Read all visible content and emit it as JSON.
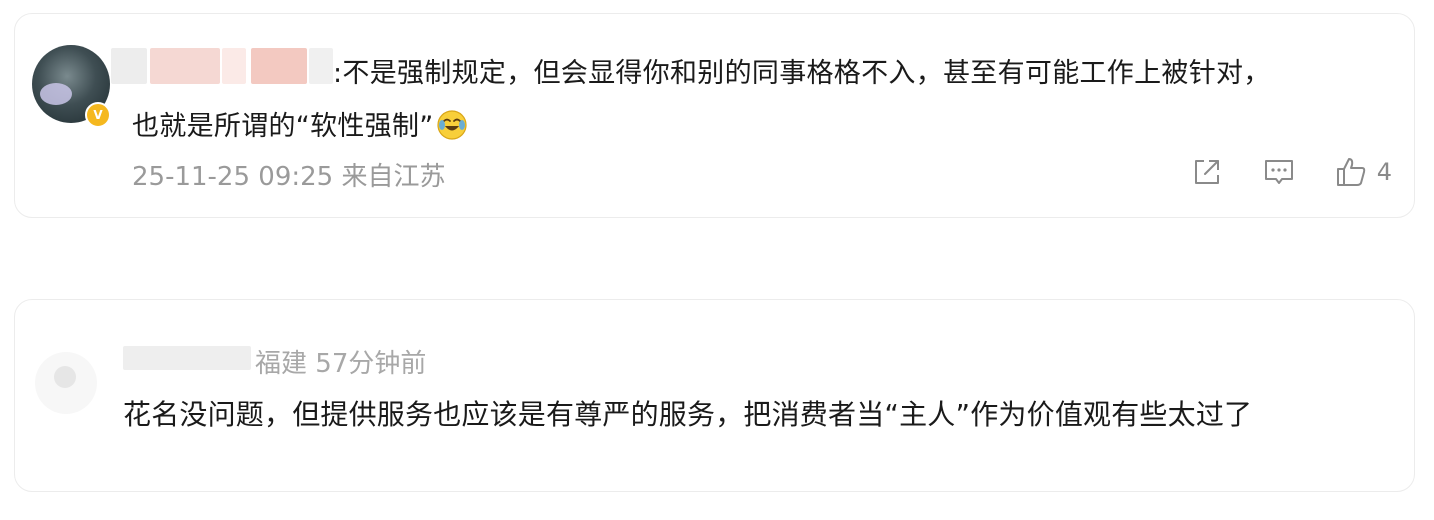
{
  "comments": [
    {
      "text_line1": ":不是强制规定，但会显得你和别的同事格格不入，甚至有可能工作上被针对，",
      "text_line2": "也就是所谓的“软性强制”",
      "emoji": "laughing-crying-emoji",
      "timestamp": "25-11-25 09:25",
      "location": "来自江苏",
      "likes": "4",
      "badge": "V",
      "icons": [
        "share-icon",
        "comment-icon",
        "thumbs-up-icon"
      ],
      "badge_color": "#f5b81f"
    },
    {
      "location": "福建",
      "time_ago": "57分钟前",
      "text": "花名没问题，但提供服务也应该是有尊严的服务，把消费者当“主人”作为价值观有些太过了"
    }
  ],
  "colors": {
    "text": "#1a1a1a",
    "meta": "#9a9a9a",
    "border": "#ececec"
  }
}
